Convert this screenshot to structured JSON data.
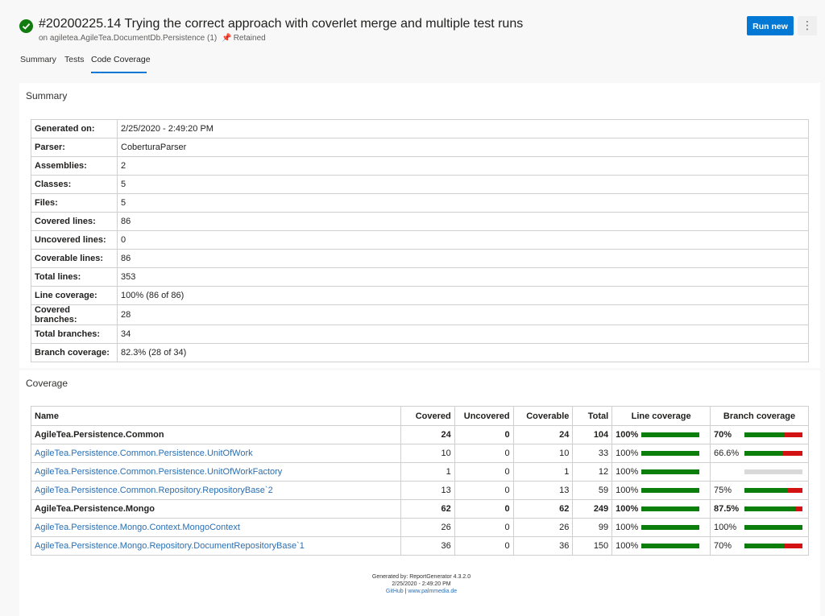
{
  "header": {
    "title": "#20200225.14 Trying the correct approach with coverlet merge and multiple test runs",
    "subtitle_prefix": "on agiletea.AgileTea.DocumentDb.Persistence (1)",
    "retained_label": "Retained",
    "run_new_label": "Run new",
    "more_label": "⋮"
  },
  "tabs": [
    {
      "label": "Summary"
    },
    {
      "label": "Tests"
    },
    {
      "label": "Code Coverage"
    }
  ],
  "summary": {
    "title": "Summary",
    "rows": [
      {
        "key": "Generated on:",
        "value": "2/25/2020 - 2:49:20 PM"
      },
      {
        "key": "Parser:",
        "value": "CoberturaParser"
      },
      {
        "key": "Assemblies:",
        "value": "2"
      },
      {
        "key": "Classes:",
        "value": "5"
      },
      {
        "key": "Files:",
        "value": "5"
      },
      {
        "key": "Covered lines:",
        "value": "86"
      },
      {
        "key": "Uncovered lines:",
        "value": "0"
      },
      {
        "key": "Coverable lines:",
        "value": "86"
      },
      {
        "key": "Total lines:",
        "value": "353"
      },
      {
        "key": "Line coverage:",
        "value": "100% (86 of 86)"
      },
      {
        "key": "Covered branches:",
        "value": "28"
      },
      {
        "key": "Total branches:",
        "value": "34"
      },
      {
        "key": "Branch coverage:",
        "value": "82.3% (28 of 34)"
      }
    ]
  },
  "coverage": {
    "title": "Coverage",
    "headers": {
      "name": "Name",
      "covered": "Covered",
      "uncovered": "Uncovered",
      "coverable": "Coverable",
      "total": "Total",
      "line_coverage": "Line coverage",
      "branch_coverage": "Branch coverage"
    },
    "rows": [
      {
        "name": "AgileTea.Persistence.Common",
        "assembly": true,
        "covered": "24",
        "uncovered": "0",
        "coverable": "24",
        "total": "104",
        "line_pct": "100%",
        "line_fraction": 1.0,
        "branch_pct": "70%",
        "branch_fraction": 0.7,
        "has_branch": true
      },
      {
        "name": "AgileTea.Persistence.Common.Persistence.UnitOfWork",
        "assembly": false,
        "covered": "10",
        "uncovered": "0",
        "coverable": "10",
        "total": "33",
        "line_pct": "100%",
        "line_fraction": 1.0,
        "branch_pct": "66.6%",
        "branch_fraction": 0.666,
        "has_branch": true
      },
      {
        "name": "AgileTea.Persistence.Common.Persistence.UnitOfWorkFactory",
        "assembly": false,
        "covered": "1",
        "uncovered": "0",
        "coverable": "1",
        "total": "12",
        "line_pct": "100%",
        "line_fraction": 1.0,
        "branch_pct": "",
        "branch_fraction": 0,
        "has_branch": false
      },
      {
        "name": "AgileTea.Persistence.Common.Repository.RepositoryBase`2",
        "assembly": false,
        "covered": "13",
        "uncovered": "0",
        "coverable": "13",
        "total": "59",
        "line_pct": "100%",
        "line_fraction": 1.0,
        "branch_pct": "75%",
        "branch_fraction": 0.75,
        "has_branch": true
      },
      {
        "name": "AgileTea.Persistence.Mongo",
        "assembly": true,
        "covered": "62",
        "uncovered": "0",
        "coverable": "62",
        "total": "249",
        "line_pct": "100%",
        "line_fraction": 1.0,
        "branch_pct": "87.5%",
        "branch_fraction": 0.875,
        "has_branch": true
      },
      {
        "name": "AgileTea.Persistence.Mongo.Context.MongoContext",
        "assembly": false,
        "covered": "26",
        "uncovered": "0",
        "coverable": "26",
        "total": "99",
        "line_pct": "100%",
        "line_fraction": 1.0,
        "branch_pct": "100%",
        "branch_fraction": 1.0,
        "has_branch": true
      },
      {
        "name": "AgileTea.Persistence.Mongo.Repository.DocumentRepositoryBase`1",
        "assembly": false,
        "covered": "36",
        "uncovered": "0",
        "coverable": "36",
        "total": "150",
        "line_pct": "100%",
        "line_fraction": 1.0,
        "branch_pct": "70%",
        "branch_fraction": 0.7,
        "has_branch": true
      }
    ]
  },
  "footer": {
    "generated_by": "Generated by: ReportGenerator 4.3.2.0",
    "date": "2/25/2020 - 2:49:20 PM",
    "github": "GitHub",
    "separator": "|",
    "website": "www.palmmedia.de"
  },
  "colors": {
    "covered": "#0b7e0b",
    "uncovered": "#d31313",
    "none": "#d9d9d9",
    "accent": "#0078d4"
  },
  "icons": {
    "status": "check-circle-icon",
    "retained": "pin-icon",
    "more": "more-vertical-icon"
  }
}
